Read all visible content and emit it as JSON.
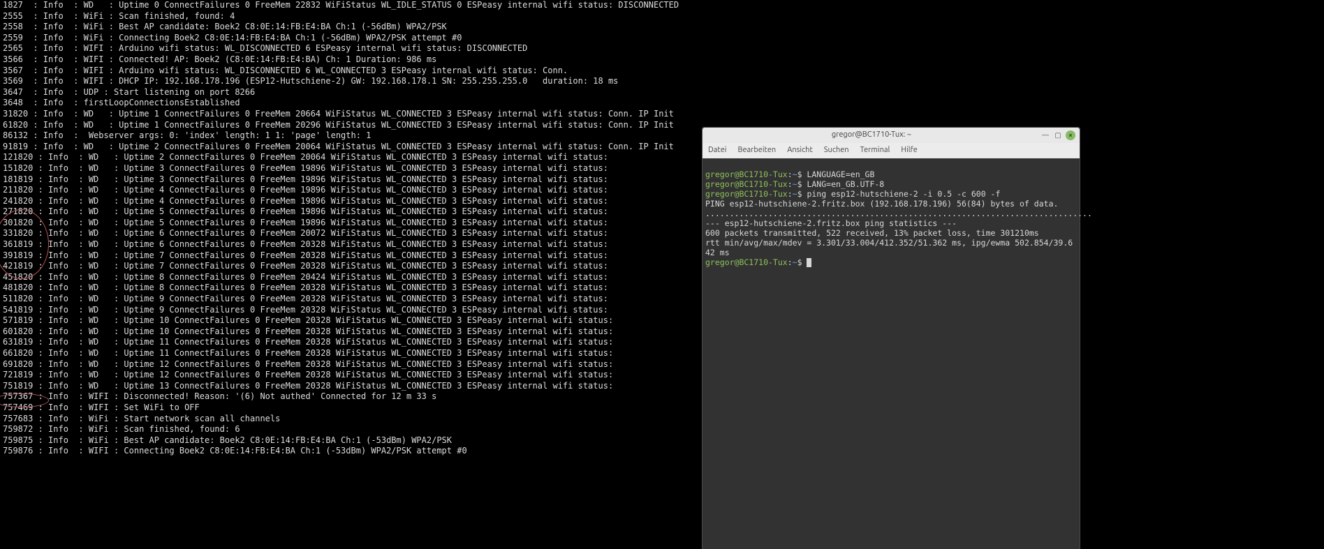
{
  "log_lines": [
    "1827  : Info  : WD   : Uptime 0 ConnectFailures 0 FreeMem 22832 WiFiStatus WL_IDLE_STATUS 0 ESPeasy internal wifi status: DISCONNECTED",
    "2555  : Info  : WiFi : Scan finished, found: 4",
    "2558  : Info  : WiFi : Best AP candidate: Boek2 C8:0E:14:FB:E4:BA Ch:1 (-56dBm) WPA2/PSK",
    "2559  : Info  : WiFi : Connecting Boek2 C8:0E:14:FB:E4:BA Ch:1 (-56dBm) WPA2/PSK attempt #0",
    "2565  : Info  : WIFI : Arduino wifi status: WL_DISCONNECTED 6 ESPeasy internal wifi status: DISCONNECTED",
    "3566  : Info  : WIFI : Connected! AP: Boek2 (C8:0E:14:FB:E4:BA) Ch: 1 Duration: 986 ms",
    "3567  : Info  : WIFI : Arduino wifi status: WL_DISCONNECTED 6 WL_CONNECTED 3 ESPeasy internal wifi status: Conn.",
    "3569  : Info  : WIFI : DHCP IP: 192.168.178.196 (ESP12-Hutschiene-2) GW: 192.168.178.1 SN: 255.255.255.0   duration: 18 ms",
    "3647  : Info  : UDP : Start listening on port 8266",
    "3648  : Info  : firstLoopConnectionsEstablished",
    "31820 : Info  : WD   : Uptime 1 ConnectFailures 0 FreeMem 20664 WiFiStatus WL_CONNECTED 3 ESPeasy internal wifi status: Conn. IP Init",
    "61820 : Info  : WD   : Uptime 1 ConnectFailures 0 FreeMem 20296 WiFiStatus WL_CONNECTED 3 ESPeasy internal wifi status: Conn. IP Init",
    "86132 : Info  :  Webserver args: 0: 'index' length: 1 1: 'page' length: 1",
    "91819 : Info  : WD   : Uptime 2 ConnectFailures 0 FreeMem 20064 WiFiStatus WL_CONNECTED 3 ESPeasy internal wifi status: Conn. IP Init",
    "121820 : Info  : WD   : Uptime 2 ConnectFailures 0 FreeMem 20064 WiFiStatus WL_CONNECTED 3 ESPeasy internal wifi status:",
    "151820 : Info  : WD   : Uptime 3 ConnectFailures 0 FreeMem 19896 WiFiStatus WL_CONNECTED 3 ESPeasy internal wifi status:",
    "181819 : Info  : WD   : Uptime 3 ConnectFailures 0 FreeMem 19896 WiFiStatus WL_CONNECTED 3 ESPeasy internal wifi status:",
    "211820 : Info  : WD   : Uptime 4 ConnectFailures 0 FreeMem 19896 WiFiStatus WL_CONNECTED 3 ESPeasy internal wifi status:",
    "241820 : Info  : WD   : Uptime 4 ConnectFailures 0 FreeMem 19896 WiFiStatus WL_CONNECTED 3 ESPeasy internal wifi status:",
    "271820 : Info  : WD   : Uptime 5 ConnectFailures 0 FreeMem 19896 WiFiStatus WL_CONNECTED 3 ESPeasy internal wifi status:",
    "301820 : Info  : WD   : Uptime 5 ConnectFailures 0 FreeMem 19896 WiFiStatus WL_CONNECTED 3 ESPeasy internal wifi status:",
    "331820 : Info  : WD   : Uptime 6 ConnectFailures 0 FreeMem 20072 WiFiStatus WL_CONNECTED 3 ESPeasy internal wifi status:",
    "361819 : Info  : WD   : Uptime 6 ConnectFailures 0 FreeMem 20328 WiFiStatus WL_CONNECTED 3 ESPeasy internal wifi status:",
    "391819 : Info  : WD   : Uptime 7 ConnectFailures 0 FreeMem 20328 WiFiStatus WL_CONNECTED 3 ESPeasy internal wifi status:",
    "421819 : Info  : WD   : Uptime 7 ConnectFailures 0 FreeMem 20328 WiFiStatus WL_CONNECTED 3 ESPeasy internal wifi status:",
    "451820 : Info  : WD   : Uptime 8 ConnectFailures 0 FreeMem 20424 WiFiStatus WL_CONNECTED 3 ESPeasy internal wifi status:",
    "481820 : Info  : WD   : Uptime 8 ConnectFailures 0 FreeMem 20328 WiFiStatus WL_CONNECTED 3 ESPeasy internal wifi status:",
    "511820 : Info  : WD   : Uptime 9 ConnectFailures 0 FreeMem 20328 WiFiStatus WL_CONNECTED 3 ESPeasy internal wifi status:",
    "541819 : Info  : WD   : Uptime 9 ConnectFailures 0 FreeMem 20328 WiFiStatus WL_CONNECTED 3 ESPeasy internal wifi status:",
    "571819 : Info  : WD   : Uptime 10 ConnectFailures 0 FreeMem 20328 WiFiStatus WL_CONNECTED 3 ESPeasy internal wifi status:",
    "601820 : Info  : WD   : Uptime 10 ConnectFailures 0 FreeMem 20328 WiFiStatus WL_CONNECTED 3 ESPeasy internal wifi status:",
    "631819 : Info  : WD   : Uptime 11 ConnectFailures 0 FreeMem 20328 WiFiStatus WL_CONNECTED 3 ESPeasy internal wifi status:",
    "661820 : Info  : WD   : Uptime 11 ConnectFailures 0 FreeMem 20328 WiFiStatus WL_CONNECTED 3 ESPeasy internal wifi status:",
    "691820 : Info  : WD   : Uptime 12 ConnectFailures 0 FreeMem 20328 WiFiStatus WL_CONNECTED 3 ESPeasy internal wifi status:",
    "721819 : Info  : WD   : Uptime 12 ConnectFailures 0 FreeMem 20328 WiFiStatus WL_CONNECTED 3 ESPeasy internal wifi status:",
    "751819 : Info  : WD   : Uptime 13 ConnectFailures 0 FreeMem 20328 WiFiStatus WL_CONNECTED 3 ESPeasy internal wifi status:",
    "757367 : Info  : WIFI : Disconnected! Reason: '(6) Not authed' Connected for 12 m 33 s",
    "757469 : Info  : WIFI : Set WiFi to OFF",
    "757683 : Info  : WiFi : Start network scan all channels",
    "759872 : Info  : WiFi : Scan finished, found: 6",
    "759875 : Info  : WiFi : Best AP candidate: Boek2 C8:0E:14:FB:E4:BA Ch:1 (-53dBm) WPA2/PSK",
    "759876 : Info  : WIFI : Connecting Boek2 C8:0E:14:FB:E4:BA Ch:1 (-53dBm) WPA2/PSK attempt #0"
  ],
  "terminal": {
    "title": "gregor@BC1710-Tux: ~",
    "menus": [
      "Datei",
      "Bearbeiten",
      "Ansicht",
      "Suchen",
      "Terminal",
      "Hilfe"
    ],
    "prompt_user": "gregor@BC1710-Tux",
    "prompt_path": "~",
    "prompt_sep": ":",
    "prompt_end": "$",
    "cmd1": "LANGUAGE=en_GB",
    "cmd2": "LANG=en_GB.UTF-8",
    "cmd3": "ping esp12-hutschiene-2 -i 0.5 -c 600 -f",
    "out1": "PING esp12-hutschiene-2.fritz.box (192.168.178.196) 56(84) bytes of data.",
    "out2": "................................................................................",
    "out3": "--- esp12-hutschiene-2.fritz.box ping statistics ---",
    "out4": "600 packets transmitted, 522 received, 13% packet loss, time 301210ms",
    "out5": "rtt min/avg/max/mdev = 3.301/33.004/412.352/51.362 ms, ipg/ewma 502.854/39.642 ms"
  }
}
